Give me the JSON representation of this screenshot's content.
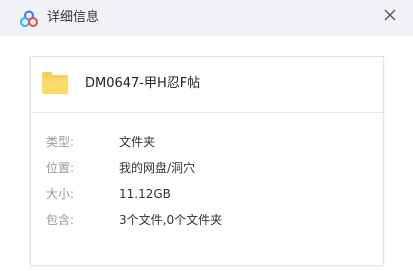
{
  "window": {
    "title": "详细信息",
    "close_glyph": "✕"
  },
  "file": {
    "name": "DM0647-甲H忍F帖",
    "icon": "folder-icon"
  },
  "details": [
    {
      "label": "类型:",
      "value": "文件夹"
    },
    {
      "label": "位置:",
      "value": "我的网盘/洞穴"
    },
    {
      "label": "大小:",
      "value": "11.12GB"
    },
    {
      "label": "包含:",
      "value": "3个文件,0个文件夹"
    }
  ],
  "colors": {
    "titlebar_bg": "#f1f3f8",
    "folder": "#f9d04f",
    "logo_blue": "#2f7ef7"
  }
}
